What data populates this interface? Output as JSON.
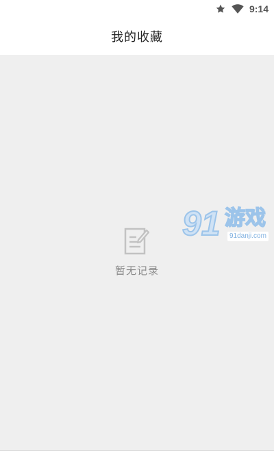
{
  "status_bar": {
    "time": "9:14",
    "icons": [
      "star-icon",
      "wifi-icon"
    ]
  },
  "header": {
    "title": "我的收藏"
  },
  "empty_state": {
    "icon": "note-edit-icon",
    "text": "暂无记录"
  },
  "watermark": {
    "digits": "91",
    "chars": "游戏",
    "url": "91danji.com"
  },
  "colors": {
    "background": "#efefef",
    "header_bg": "#ffffff",
    "title_text": "#222222",
    "empty_text": "#8a8a8a",
    "watermark_blue": "#9cc4ea"
  }
}
